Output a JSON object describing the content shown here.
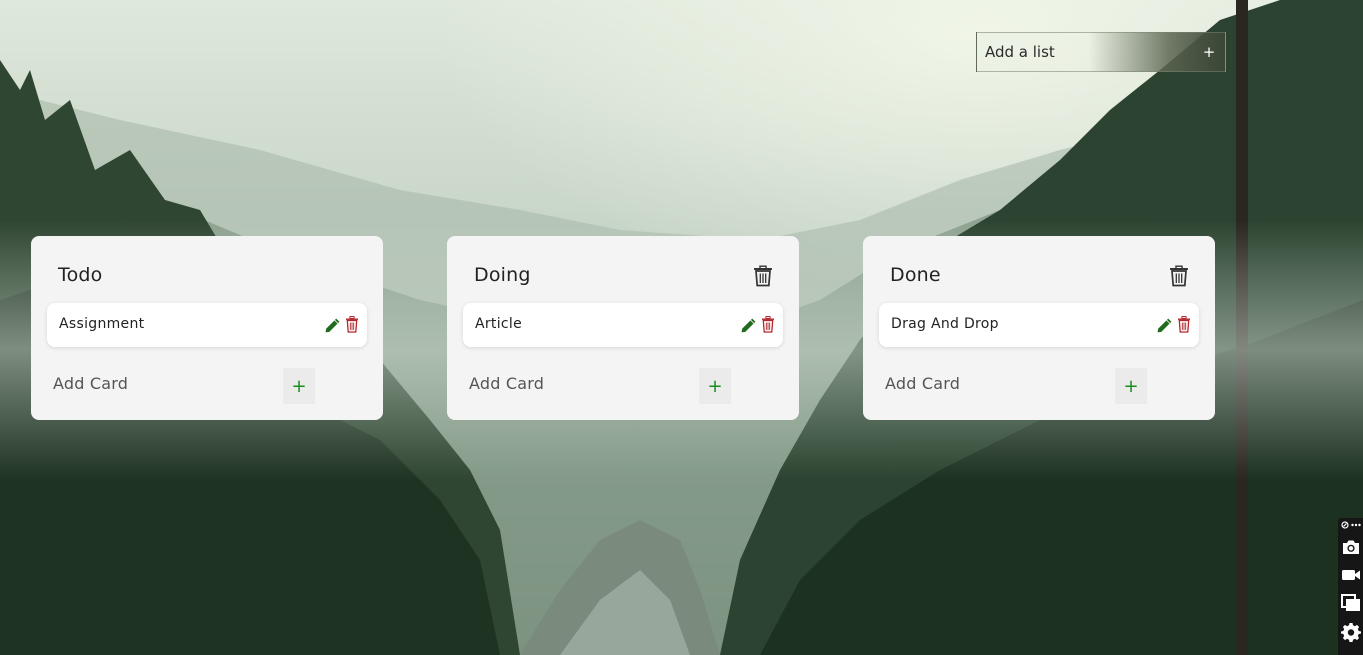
{
  "add_list": {
    "placeholder": "Add a list",
    "add_symbol": "+"
  },
  "lists": [
    {
      "title": "Todo",
      "cards": [
        {
          "text": "Assignment"
        }
      ],
      "add_card_label": "Add Card",
      "add_symbol": "+"
    },
    {
      "title": "Doing",
      "cards": [
        {
          "text": "Article"
        }
      ],
      "add_card_label": "Add Card",
      "add_symbol": "+"
    },
    {
      "title": "Done",
      "cards": [
        {
          "text": "Drag And Drop"
        }
      ],
      "add_card_label": "Add Card",
      "add_symbol": "+"
    }
  ],
  "colors": {
    "edit_icon": "#1f6b1f",
    "card_delete_icon": "#b3262b",
    "add_card_plus": "#1c8a1c",
    "list_bg": "#f4f4f4",
    "card_bg": "#ffffff"
  },
  "icons": {
    "add_list_button": "plus-icon",
    "list_delete": "trash-icon",
    "card_edit": "pencil-icon",
    "card_delete": "trash-icon",
    "toolbar": [
      "link-icon",
      "more-icon",
      "camera-icon",
      "video-icon",
      "copy-icon",
      "gear-icon"
    ]
  }
}
